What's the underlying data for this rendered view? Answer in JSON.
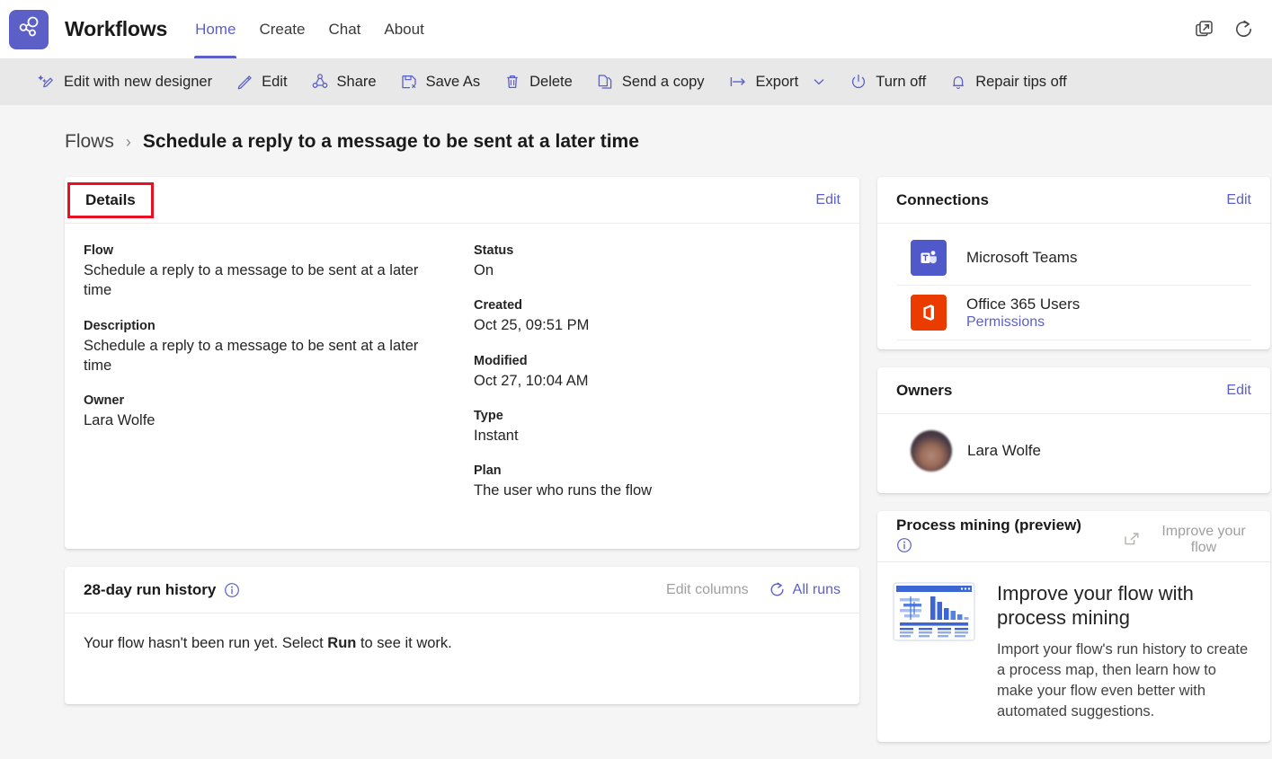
{
  "app": {
    "logo_icon": "share-network-icon",
    "title": "Workflows",
    "tabs": [
      {
        "label": "Home",
        "active": true
      },
      {
        "label": "Create",
        "active": false
      },
      {
        "label": "Chat",
        "active": false
      },
      {
        "label": "About",
        "active": false
      }
    ],
    "right_icons": [
      {
        "name": "pop-out-icon"
      },
      {
        "name": "refresh-icon"
      }
    ]
  },
  "commandbar": {
    "items": [
      {
        "label": "Edit with new designer",
        "icon": "magic-pencil-icon",
        "chevron": false
      },
      {
        "label": "Edit",
        "icon": "pencil-icon",
        "chevron": false
      },
      {
        "label": "Share",
        "icon": "share-icon",
        "chevron": false
      },
      {
        "label": "Save As",
        "icon": "save-icon",
        "chevron": false
      },
      {
        "label": "Delete",
        "icon": "trash-icon",
        "chevron": false
      },
      {
        "label": "Send a copy",
        "icon": "copy-icon",
        "chevron": false
      },
      {
        "label": "Export",
        "icon": "export-arrow-icon",
        "chevron": true
      },
      {
        "label": "Turn off",
        "icon": "power-icon",
        "chevron": false
      },
      {
        "label": "Repair tips off",
        "icon": "bell-icon",
        "chevron": false
      }
    ]
  },
  "breadcrumb": {
    "parent": "Flows",
    "separator": "›",
    "current": "Schedule a reply to a message to be sent at a later time"
  },
  "details": {
    "title": "Details",
    "edit_label": "Edit",
    "left_fields": [
      {
        "label": "Flow",
        "value": "Schedule a reply to a message to be sent at a later time"
      },
      {
        "label": "Description",
        "value": "Schedule a reply to a message to be sent at a later time"
      },
      {
        "label": "Owner",
        "value": "Lara Wolfe"
      }
    ],
    "right_fields": [
      {
        "label": "Status",
        "value": "On"
      },
      {
        "label": "Created",
        "value": "Oct 25, 09:51 PM"
      },
      {
        "label": "Modified",
        "value": "Oct 27, 10:04 AM"
      },
      {
        "label": "Type",
        "value": "Instant"
      },
      {
        "label": "Plan",
        "value": "The user who runs the flow"
      }
    ]
  },
  "run_history": {
    "title": "28-day run history",
    "info_icon": "info-icon",
    "edit_columns_label": "Edit columns",
    "all_runs_label": "All runs",
    "all_runs_icon": "refresh-icon",
    "empty_text_before": "Your flow hasn't been run yet. Select ",
    "empty_text_bold": "Run",
    "empty_text_after": " to see it work."
  },
  "connections": {
    "title": "Connections",
    "edit_label": "Edit",
    "items": [
      {
        "name": "Microsoft Teams",
        "sub": "",
        "icon": "microsoft-teams-icon",
        "color": "#5059C9"
      },
      {
        "name": "Office 365 Users",
        "sub": "Permissions",
        "icon": "office-365-icon",
        "color": "#EB3C00"
      }
    ]
  },
  "owners": {
    "title": "Owners",
    "edit_label": "Edit",
    "items": [
      {
        "name": "Lara Wolfe",
        "avatar": "user-avatar"
      }
    ]
  },
  "process_mining": {
    "title": "Process mining (preview)",
    "info_icon": "info-icon",
    "link_label": "Improve your flow",
    "link_icon": "open-in-new-icon",
    "thumb_icon": "process-mining-chart-thumbnail",
    "heading": "Improve your flow with process mining",
    "description": "Import your flow's run history to create a process map, then learn how to make your flow even better with automated suggestions."
  },
  "colors": {
    "accent": "#5b5fc7",
    "annotation": "#e81123",
    "page_bg": "#f5f5f5",
    "cmdbar_bg": "#e8e8e8",
    "muted_text": "#a19f9d"
  }
}
